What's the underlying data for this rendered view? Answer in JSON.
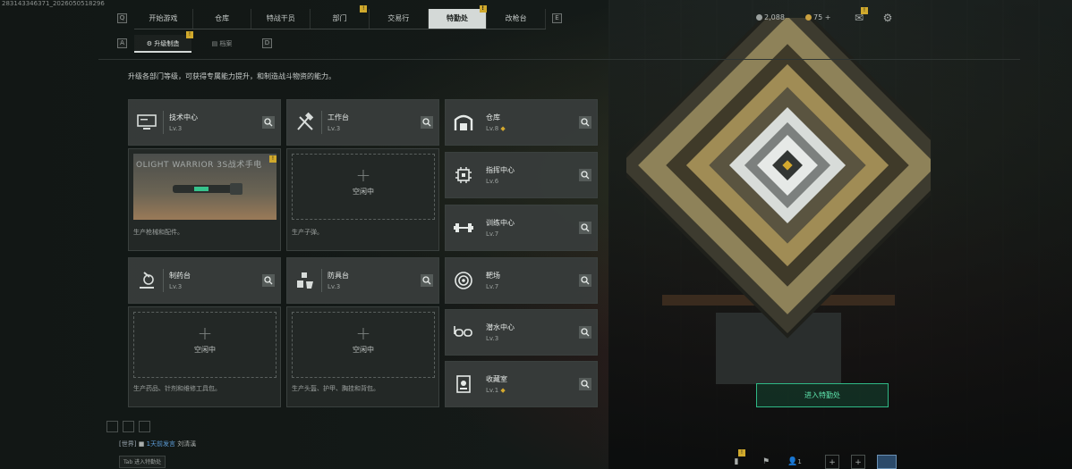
{
  "build_id": "283143346371_2026050518296",
  "nav": {
    "key_left": "Q",
    "key_right": "E",
    "tabs": [
      "开始游戏",
      "仓库",
      "特战干员",
      "部门",
      "交易行",
      "特勤处",
      "改枪台"
    ],
    "active_tab": "特勤处",
    "tab_badges": [
      "!",
      "!",
      "!"
    ]
  },
  "currency": {
    "coins": "2,088",
    "tickets": "75 +"
  },
  "subtabs": {
    "key_left": "A",
    "key_right": "D",
    "items": [
      "升级制造",
      "档案"
    ],
    "active": "升级制造",
    "badge": "!"
  },
  "description": "升级各部门等级，可获得专属能力提升，和制造战斗物资的能力。",
  "workshops": [
    {
      "name": "技术中心",
      "level": "Lv.3",
      "icon": "monitor-icon",
      "slot_product": "OLIGHT WARRIOR 3S战术手电",
      "slot_badge": "!",
      "caption": "生产枪械和配件。"
    },
    {
      "name": "工作台",
      "level": "Lv.3",
      "icon": "tools-icon",
      "slot_state": "空闲中",
      "caption": "生产子弹。"
    },
    {
      "name": "制药台",
      "level": "Lv.3",
      "icon": "microscope-icon",
      "slot_state": "空闲中",
      "caption": "生产药品、针剂和维修工具包。"
    },
    {
      "name": "防具台",
      "level": "Lv.3",
      "icon": "armor-icon",
      "slot_state": "空闲中",
      "caption": "生产头盔、护甲、胸挂和背包。"
    }
  ],
  "departments": [
    {
      "name": "仓库",
      "level": "Lv.8",
      "upgrade": true,
      "icon": "warehouse-icon"
    },
    {
      "name": "指挥中心",
      "level": "Lv.6",
      "upgrade": false,
      "icon": "chip-icon"
    },
    {
      "name": "训练中心",
      "level": "Lv.7",
      "upgrade": false,
      "icon": "dumbbell-icon"
    },
    {
      "name": "靶场",
      "level": "Lv.7",
      "upgrade": false,
      "icon": "target-icon"
    },
    {
      "name": "潜水中心",
      "level": "Lv.3",
      "upgrade": false,
      "icon": "diving-mask-icon"
    },
    {
      "name": "收藏室",
      "level": "Lv.1",
      "upgrade": true,
      "icon": "collection-icon"
    }
  ],
  "upgrade_symbol": "◆",
  "plus": "+",
  "enter_button": "进入特勤处",
  "chat": {
    "channel": "[世界]",
    "message": "1天前发言",
    "user": "刘清溪"
  },
  "tab_hint": "Tab 进入特勤处",
  "bottom_bar": {
    "badge": "!",
    "friends": "1"
  },
  "colors": {
    "accent_green": "#2fb986",
    "upgrade_gold": "#d4a92e",
    "active_tab": "#d4d9d7"
  }
}
